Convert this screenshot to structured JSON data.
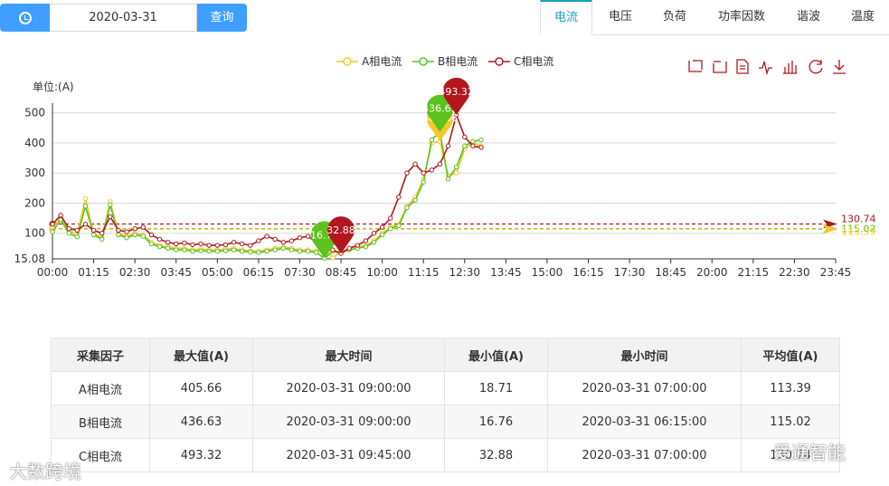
{
  "toolbar": {
    "date_value": "2020-03-31",
    "query_label": "查询",
    "icon": "clock-icon"
  },
  "tabs": [
    {
      "label": "电流",
      "active": true
    },
    {
      "label": "电压",
      "active": false
    },
    {
      "label": "负荷",
      "active": false
    },
    {
      "label": "功率因数",
      "active": false
    },
    {
      "label": "谐波",
      "active": false
    },
    {
      "label": "温度",
      "active": false
    }
  ],
  "chart_data": {
    "type": "line",
    "ylabel": "单位:(A)",
    "ylim": [
      15.08,
      520
    ],
    "yticks": [
      "500",
      "400",
      "300",
      "200",
      "100",
      "15.08"
    ],
    "x_ticks": [
      "00:00",
      "01:15",
      "02:30",
      "03:45",
      "05:00",
      "06:15",
      "07:30",
      "08:45",
      "10:00",
      "11:15",
      "12:30",
      "13:45",
      "15:00",
      "16:15",
      "17:30",
      "18:45",
      "20:00",
      "21:15",
      "22:30",
      "23:45"
    ],
    "slots_per_day": 96,
    "legend": [
      "A相电流",
      "B相电流",
      "C相电流"
    ],
    "colors": [
      "#f5c727",
      "#5bc21e",
      "#b3161f"
    ],
    "series": [
      {
        "name": "A相电流",
        "values": [
          120,
          150,
          110,
          95,
          215,
          100,
          85,
          205,
          100,
          90,
          100,
          95,
          70,
          60,
          55,
          50,
          50,
          45,
          48,
          45,
          45,
          48,
          50,
          45,
          42,
          40,
          45,
          50,
          55,
          50,
          45,
          45,
          40,
          45,
          18.71,
          40,
          50,
          55,
          60,
          75,
          100,
          120,
          130,
          190,
          220,
          280,
          400,
          405.66,
          290,
          300,
          380,
          400,
          390
        ]
      },
      {
        "name": "B相电流",
        "values": [
          105,
          145,
          100,
          88,
          190,
          95,
          80,
          195,
          95,
          85,
          95,
          90,
          65,
          55,
          50,
          45,
          45,
          40,
          42,
          40,
          40,
          42,
          45,
          40,
          38,
          36,
          40,
          45,
          50,
          45,
          40,
          40,
          36,
          16.76,
          40,
          35,
          45,
          50,
          55,
          70,
          95,
          115,
          125,
          185,
          210,
          270,
          410,
          436.63,
          280,
          320,
          390,
          405,
          410
        ]
      },
      {
        "name": "C相电流",
        "values": [
          130,
          160,
          115,
          110,
          130,
          110,
          100,
          155,
          110,
          105,
          115,
          120,
          95,
          80,
          70,
          65,
          68,
          62,
          65,
          60,
          60,
          62,
          70,
          65,
          60,
          75,
          90,
          80,
          70,
          75,
          85,
          90,
          70,
          60,
          45,
          32.88,
          50,
          60,
          75,
          100,
          120,
          150,
          220,
          300,
          330,
          300,
          310,
          330,
          390,
          493.32,
          420,
          390,
          385
        ]
      }
    ],
    "markers": [
      {
        "series": "A相电流",
        "label": "405.66",
        "index": 47,
        "value": 405.66
      },
      {
        "series": "B相电流",
        "label": "436.63",
        "index": 47,
        "value": 436.63
      },
      {
        "series": "C相电流",
        "label": "493.32",
        "index": 49,
        "value": 493.32
      },
      {
        "series": "B相电流",
        "label": "16.76",
        "index": 33,
        "value": 16.76
      },
      {
        "series": "C相电流",
        "label": "32.88",
        "index": 35,
        "value": 32.88
      }
    ],
    "avg_lines": [
      {
        "label": "130.74",
        "value": 130.74,
        "color": "#b3161f"
      },
      {
        "label": "115.02",
        "value": 115.02,
        "color": "#5bc21e"
      },
      {
        "label": "113.39",
        "value": 113.39,
        "color": "#f5c727"
      }
    ],
    "tool_icons": [
      "zoom-icon",
      "zoom-reset-icon",
      "data-view-icon",
      "line-type-icon",
      "bar-type-icon",
      "restore-icon",
      "download-icon"
    ]
  },
  "table": {
    "headers": [
      "采集因子",
      "最大值(A)",
      "最大时间",
      "最小值(A)",
      "最小时间",
      "平均值(A)"
    ],
    "rows": [
      [
        "A相电流",
        "405.66",
        "2020-03-31 09:00:00",
        "18.71",
        "2020-03-31 07:00:00",
        "113.39"
      ],
      [
        "B相电流",
        "436.63",
        "2020-03-31 09:00:00",
        "16.76",
        "2020-03-31 06:15:00",
        "115.02"
      ],
      [
        "C相电流",
        "493.32",
        "2020-03-31 09:45:00",
        "32.88",
        "2020-03-31 07:00:00",
        "130.74"
      ]
    ]
  },
  "watermarks": {
    "left": "大数跨境",
    "right": "爱通智能"
  }
}
